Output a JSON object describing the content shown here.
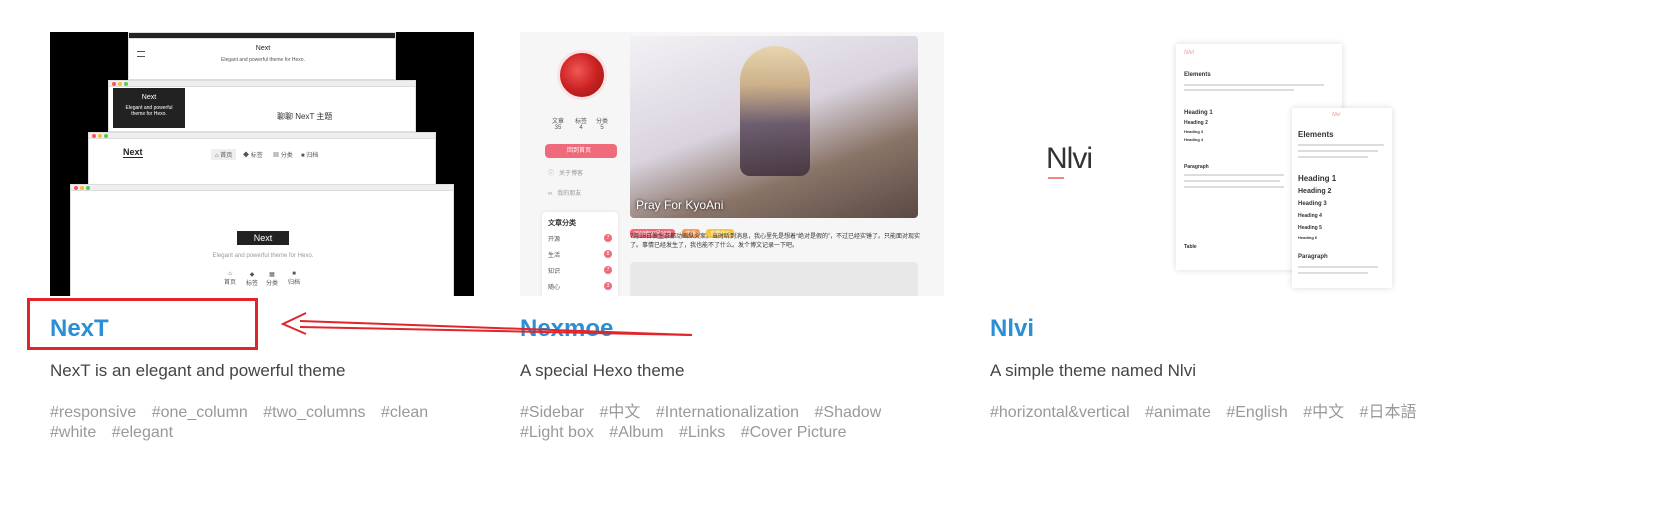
{
  "cards": [
    {
      "title": "NexT",
      "description": "NexT is an elegant and powerful theme",
      "tags": [
        "#responsive",
        "#one_column",
        "#two_columns",
        "#clean",
        "#white",
        "#elegant"
      ],
      "thumbnail": {
        "brand": "Next",
        "subtitle": "Elegant and powerful theme for Hexo.",
        "subtitle_short": "Elegant and powerful theme for Hexo.",
        "heading_cn": "聊聊 NexT 主题",
        "menu": [
          "首页",
          "标签",
          "分类",
          "归档"
        ]
      }
    },
    {
      "title": "Nexmoe",
      "description": "A special Hexo theme",
      "tags": [
        "#Sidebar",
        "#中文",
        "#Internationalization",
        "#Shadow",
        "#Light box",
        "#Album",
        "#Links",
        "#Cover Picture"
      ],
      "thumbnail": {
        "stats": [
          {
            "label": "文章",
            "value": "35"
          },
          {
            "label": "标签",
            "value": "4"
          },
          {
            "label": "分类",
            "value": "5"
          }
        ],
        "nav": [
          "回到首页",
          "关于博客",
          "我的朋友"
        ],
        "categories_title": "文章分类",
        "categories": [
          {
            "name": "开源",
            "count": "7"
          },
          {
            "name": "生活",
            "count": "8"
          },
          {
            "name": "知识",
            "count": "7"
          },
          {
            "name": "随心",
            "count": "3"
          }
        ],
        "post_caption": "Pray For KyoAni",
        "post_tags": [
          "2019年07月19日",
          "生活",
          "京都动画"
        ],
        "post_text": "7月18日发生京都动画纵火案。当时听到消息，我心里先是想着“绝对是假的”，不过已经实锤了。只能面对现实了。事情已经发生了，我也能不了什么。发个博文记录一下吧。"
      }
    },
    {
      "title": "Nlvi",
      "description": "A simple theme named Nlvi",
      "tags": [
        "#horizontal&vertical",
        "#animate",
        "#English",
        "#中文",
        "#日本語"
      ],
      "thumbnail": {
        "logo": "Nlvi",
        "page_title": "Elements",
        "headings": [
          "Heading 1",
          "Heading 2",
          "Heading 3",
          "Heading 4",
          "Heading 5",
          "Heading 6"
        ],
        "paragraph_label": "Paragraph",
        "table_label": "Table"
      }
    }
  ],
  "annotation": {
    "color": "#e0262a",
    "target": "NexT title"
  },
  "colors": {
    "title_link": "#2a8fd6",
    "tag_text": "#999999",
    "nexmoe_accent": "#ef6b7c"
  }
}
